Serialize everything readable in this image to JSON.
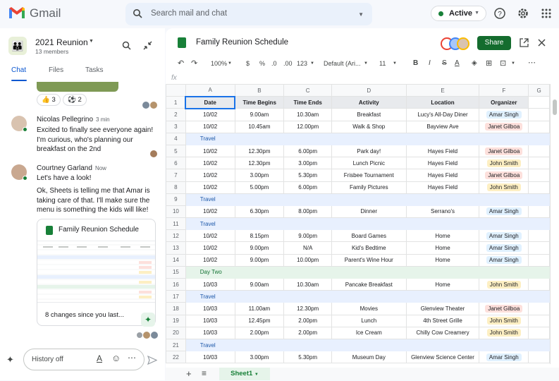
{
  "topbar": {
    "app_name": "Gmail",
    "search_placeholder": "Search mail and chat",
    "status": "Active"
  },
  "chat": {
    "room_name": "2021 Reunion",
    "members": "13 members",
    "tabs": [
      "Chat",
      "Files",
      "Tasks"
    ],
    "reactions": [
      {
        "emoji": "👍",
        "count": "3"
      },
      {
        "emoji": "⚽",
        "count": "2"
      }
    ],
    "messages": [
      {
        "name": "Nicolas Pellegrino",
        "time": "3 min",
        "text": "Excited to finally see everyone again! I'm curious, who's planning our breakfast on the 2nd"
      },
      {
        "name": "Courtney Garland",
        "time": "Now",
        "text1": "Let's have a look!",
        "text2": "Ok, Sheets is telling me that Amar is taking care of that. I'll make sure the menu is something the kids will like!"
      }
    ],
    "card_title": "Family Reunion Schedule",
    "card_changes": "8 changes since you last...",
    "input_placeholder": "History off"
  },
  "sheet": {
    "title": "Family Reunion Schedule",
    "share_label": "Share",
    "toolbar": {
      "zoom": "100%",
      "currency": "$",
      "percent": "%",
      "dec_less": ".0",
      "dec_more": ".00",
      "format": "123",
      "font": "Default (Ari...",
      "size": "11",
      "bold": "B",
      "italic": "I",
      "strike": "S",
      "text_color": "A",
      "more": "⋯"
    },
    "fx": "fx",
    "columns": [
      "A",
      "B",
      "C",
      "D",
      "E",
      "F",
      "G"
    ],
    "headers": [
      "Date",
      "Time Begins",
      "Time Ends",
      "Activity",
      "Location",
      "Organizer"
    ],
    "rows": [
      {
        "type": "data",
        "cells": [
          "10/02",
          "9.00am",
          "10.30am",
          "Breakfast",
          "Lucy's All-Day Diner",
          "Amar Singh"
        ]
      },
      {
        "type": "data",
        "cells": [
          "10/02",
          "10.45am",
          "12.00pm",
          "Walk & Shop",
          "Bayview Ave",
          "Janet Gilboa"
        ]
      },
      {
        "type": "section",
        "label": "Travel"
      },
      {
        "type": "data",
        "cells": [
          "10/02",
          "12.30pm",
          "6.00pm",
          "Park day!",
          "Hayes Field",
          "Janet Gilboa"
        ]
      },
      {
        "type": "data",
        "cells": [
          "10/02",
          "12.30pm",
          "3.00pm",
          "Lunch Picnic",
          "Hayes Field",
          "John Smith"
        ]
      },
      {
        "type": "data",
        "cells": [
          "10/02",
          "3.00pm",
          "5.30pm",
          "Frisbee Tournament",
          "Hayes Field",
          "Janet Gilboa"
        ]
      },
      {
        "type": "data",
        "cells": [
          "10/02",
          "5.00pm",
          "6.00pm",
          "Family Pictures",
          "Hayes Field",
          "John Smith"
        ]
      },
      {
        "type": "section",
        "label": "Travel"
      },
      {
        "type": "data",
        "cells": [
          "10/02",
          "6.30pm",
          "8.00pm",
          "Dinner",
          "Serrano's",
          "Amar Singh"
        ]
      },
      {
        "type": "section",
        "label": "Travel"
      },
      {
        "type": "data",
        "cells": [
          "10/02",
          "8.15pm",
          "9.00pm",
          "Board Games",
          "Home",
          "Amar Singh"
        ]
      },
      {
        "type": "data",
        "cells": [
          "10/02",
          "9.00pm",
          "N/A",
          "Kid's Bedtime",
          "Home",
          "Amar Singh"
        ]
      },
      {
        "type": "data",
        "cells": [
          "10/02",
          "9.00pm",
          "10.00pm",
          "Parent's Wine Hour",
          "Home",
          "Amar Singh"
        ]
      },
      {
        "type": "day",
        "label": "Day Two"
      },
      {
        "type": "data",
        "cells": [
          "10/03",
          "9.00am",
          "10.30am",
          "Pancake Breakfast",
          "Home",
          "John Smith"
        ]
      },
      {
        "type": "section",
        "label": "Travel"
      },
      {
        "type": "data",
        "cells": [
          "10/03",
          "11.00am",
          "12.30pm",
          "Movies",
          "Glenview Theater",
          "Janet Gilboa"
        ]
      },
      {
        "type": "data",
        "cells": [
          "10/03",
          "12.45pm",
          "2.00pm",
          "Lunch",
          "4th Street Grille",
          "John Smith"
        ]
      },
      {
        "type": "data",
        "cells": [
          "10/03",
          "2.00pm",
          "2.00pm",
          "Ice Cream",
          "Chilly Cow Creamery",
          "John Smith"
        ]
      },
      {
        "type": "section",
        "label": "Travel"
      },
      {
        "type": "data",
        "cells": [
          "10/03",
          "3.00pm",
          "5.30pm",
          "Museum Day",
          "Glenview Science Center",
          "Amar Singh"
        ]
      }
    ],
    "sheet_tab": "Sheet1"
  },
  "colors": {
    "green": "#188038",
    "blue": "#0b57d0",
    "amar": "#e0f1ff",
    "janet": "#fde0dc",
    "john": "#fdefc3"
  }
}
